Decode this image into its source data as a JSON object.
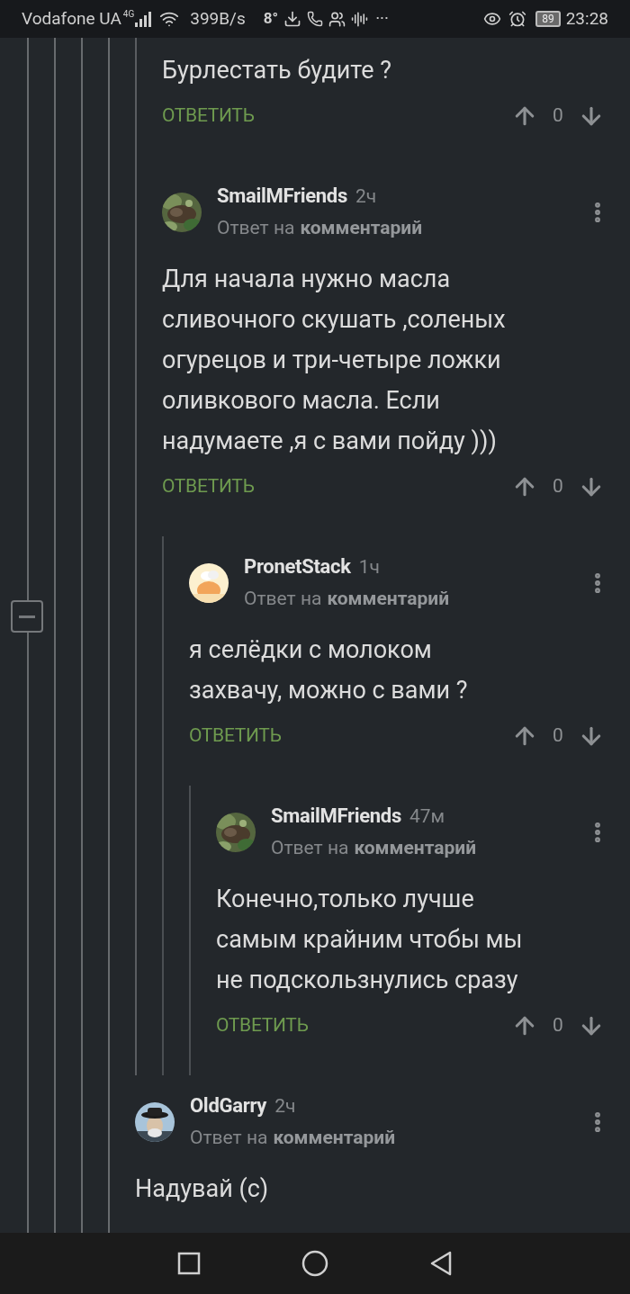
{
  "status_bar": {
    "carrier": "Vodafone UA",
    "network": "4G",
    "speed": "399B/s",
    "temperature": "8°",
    "more": "···",
    "battery": "89",
    "time": "23:28"
  },
  "collapse_button": {
    "expanded": true
  },
  "earlier_replies": [
    {
      "text": "Бурлестать будите ?",
      "reply": "ОТВЕТИТЬ",
      "score": "0"
    },
    {
      "author": "SmailMFriends",
      "time": "2ч",
      "reply_prefix": "Ответ на",
      "reply_link": "комментарий",
      "text": "Для начала нужно масла\nсливочного скушать ,соленых\nогурецов и три-четыре ложки\nоливкового масла. Если\nнадумаете ,я с вами пойду )))",
      "reply": "ОТВЕТИТЬ",
      "score": "0",
      "children": [
        {
          "author": "PronetStack",
          "time": "1ч",
          "reply_prefix": "Ответ на",
          "reply_link": "комментарий",
          "text": "я селёдки с молоком\nзахвачу, можно с вами ?",
          "reply": "ОТВЕТИТЬ",
          "score": "0",
          "children": [
            {
              "author": "SmailMFriends",
              "time": "47м",
              "reply_prefix": "Ответ на",
              "reply_link": "комментарий",
              "text": "Конечно,только лучше\nсамым крайним чтобы мы\nне подскользнулись сразу",
              "reply": "ОТВЕТИТЬ",
              "score": "0"
            }
          ]
        }
      ]
    }
  ],
  "comments": [
    {
      "author": "OldGarry",
      "time": "2ч",
      "reply_prefix": "Ответ на",
      "reply_link": "комментарий",
      "text": "Надувай (с)"
    }
  ]
}
